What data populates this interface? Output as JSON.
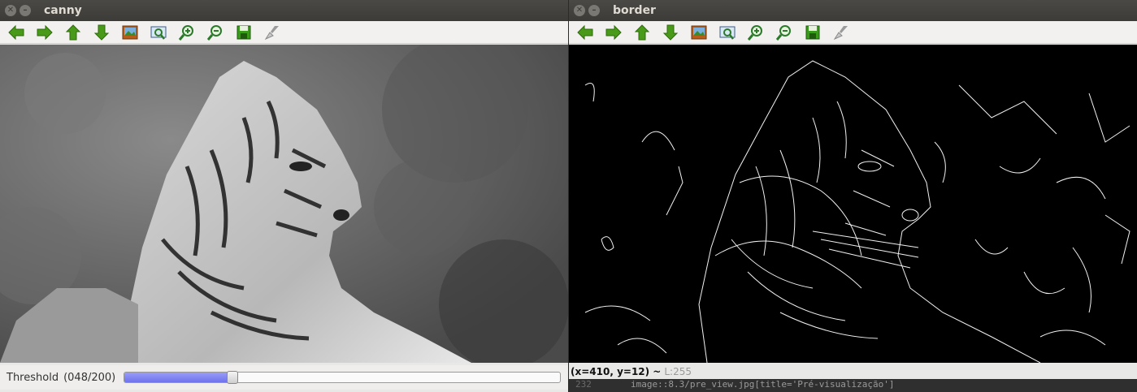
{
  "canny_window": {
    "title": "canny",
    "toolbar": [
      "arrow-left-icon",
      "arrow-right-icon",
      "arrow-up-icon",
      "arrow-down-icon",
      "image-icon",
      "zoom-fit-icon",
      "zoom-in-icon",
      "zoom-out-icon",
      "save-icon",
      "properties-icon"
    ],
    "trackbar": {
      "label": "Threshold",
      "value_text": "(048/200)",
      "value": 48,
      "max": 200
    }
  },
  "border_window": {
    "title": "border",
    "toolbar": [
      "arrow-left-icon",
      "arrow-right-icon",
      "arrow-up-icon",
      "arrow-down-icon",
      "image-icon",
      "zoom-fit-icon",
      "zoom-in-icon",
      "zoom-out-icon",
      "save-icon",
      "properties-icon"
    ],
    "status": {
      "coords": "(x=410, y=12) ~",
      "luminance": "L:255"
    },
    "editor_behind": {
      "line_number": "232",
      "code": "image::8.3/pre_view.jpg[title='Pré-visualização']"
    }
  },
  "colors": {
    "titlebar": "#3c3b37",
    "green_icon": "#4a9a1a",
    "slider_fill": "#7b7ff0"
  }
}
